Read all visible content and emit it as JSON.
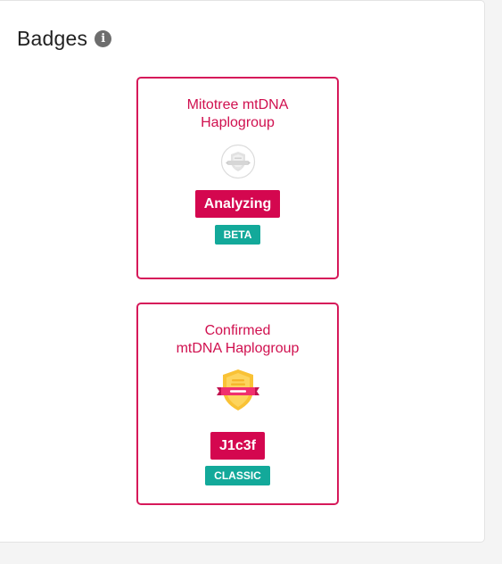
{
  "section": {
    "title": "Badges",
    "info_icon": "info-icon"
  },
  "cards": [
    {
      "title_line1": "Mitotree mtDNA",
      "title_line2": "Haplogroup",
      "icon": "placeholder-shield-icon",
      "value": "Analyzing",
      "tag": "BETA"
    },
    {
      "title_line1": "Confirmed",
      "title_line2": "mtDNA Haplogroup",
      "icon": "gold-shield-ribbon-icon",
      "value": "J1c3f",
      "tag": "CLASSIC"
    }
  ],
  "colors": {
    "accent": "#d4074f",
    "tag": "#13a99a",
    "border": "#d6195a"
  }
}
